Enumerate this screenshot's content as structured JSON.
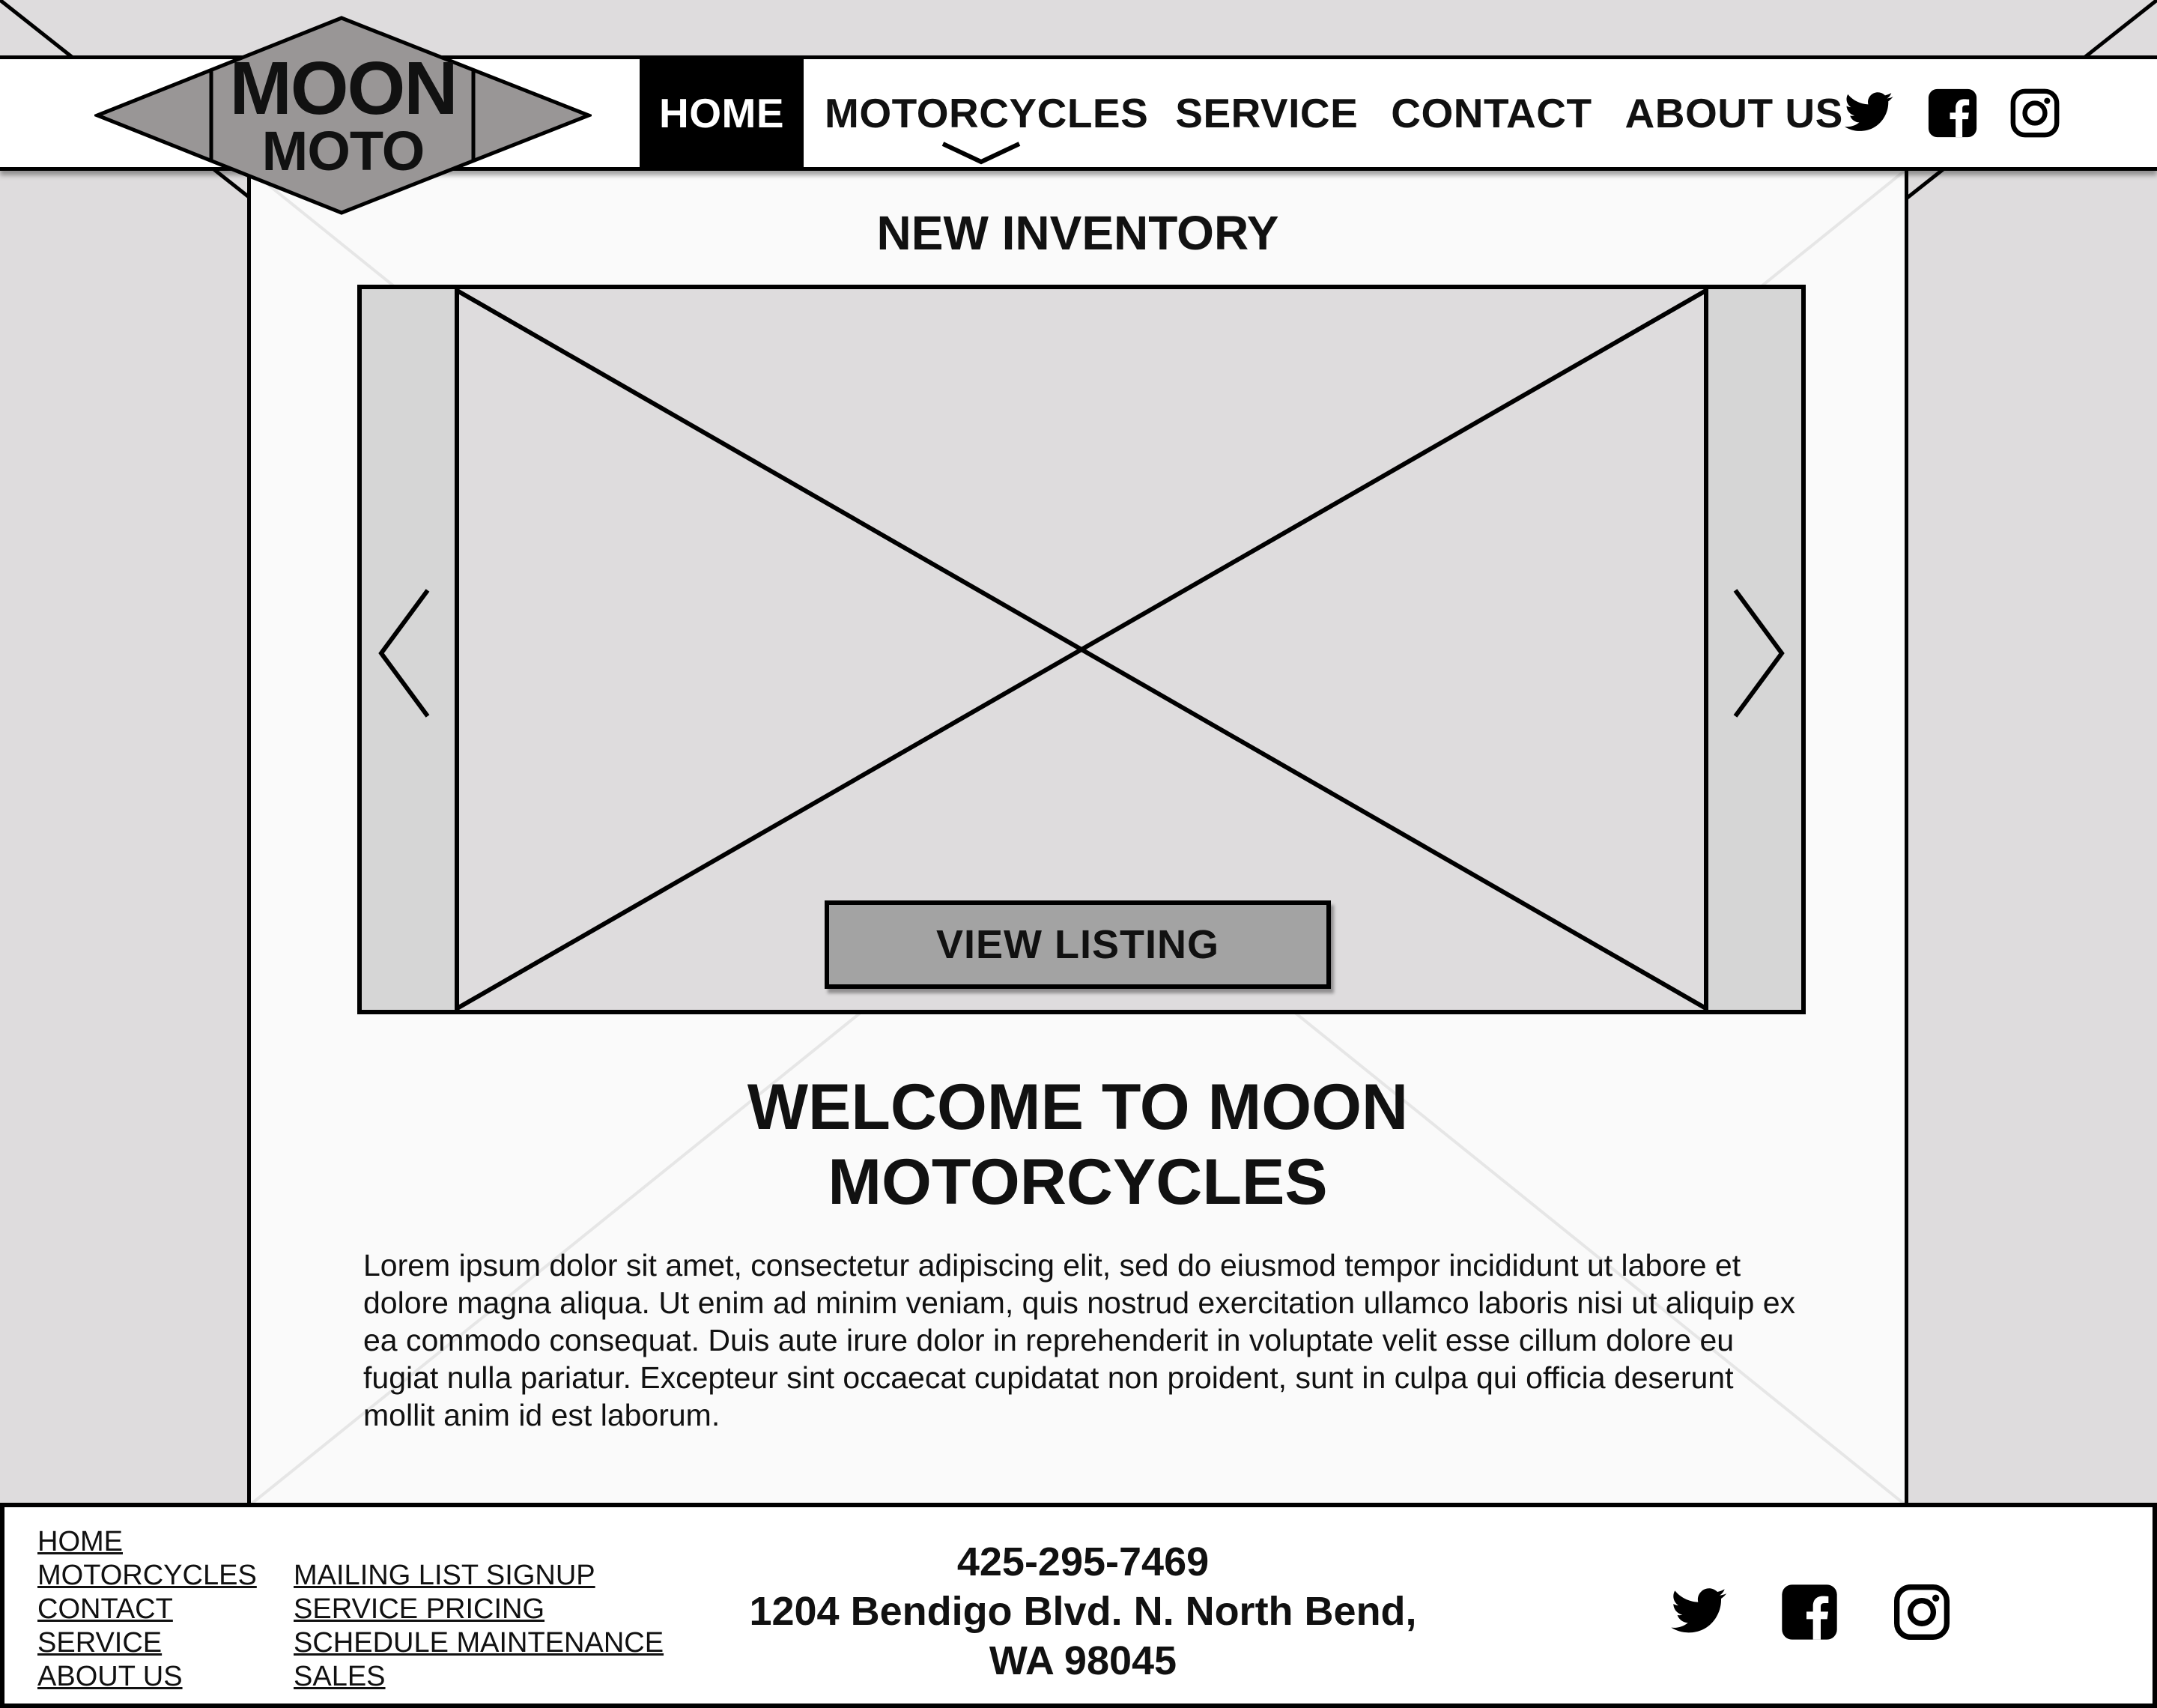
{
  "brand": {
    "line1": "MOON",
    "line2": "MOTO"
  },
  "nav": {
    "items": [
      {
        "label": "HOME",
        "active": true
      },
      {
        "label": "MOTORCYCLES",
        "active": false
      },
      {
        "label": "SERVICE",
        "active": false
      },
      {
        "label": "CONTACT",
        "active": false
      },
      {
        "label": "ABOUT US",
        "active": false
      }
    ],
    "social": [
      "twitter-icon",
      "facebook-icon",
      "instagram-icon"
    ]
  },
  "main": {
    "section_title": "NEW INVENTORY",
    "carousel": {
      "button_label": "VIEW LISTING",
      "prev_icon": "chevron-left-icon",
      "next_icon": "chevron-right-icon"
    },
    "welcome_line1": "WELCOME TO MOON",
    "welcome_line2": "MOTORCYCLES",
    "body": "Lorem ipsum dolor sit amet, consectetur adipiscing elit, sed do eiusmod tempor incididunt ut labore et dolore magna aliqua. Ut enim ad minim veniam, quis nostrud exercitation ullamco laboris nisi ut aliquip ex ea commodo consequat. Duis aute irure dolor in reprehenderit in voluptate velit esse cillum dolore eu fugiat nulla pariatur. Excepteur sint occaecat cupidatat non proident, sunt in culpa qui officia deserunt mollit anim id est laborum."
  },
  "footer": {
    "col1": [
      "HOME",
      "MOTORCYCLES",
      "CONTACT",
      "SERVICE",
      "ABOUT US"
    ],
    "col2": [
      "MAILING LIST SIGNUP",
      "SERVICE PRICING",
      "SCHEDULE MAINTENANCE",
      "SALES"
    ],
    "phone": "425-295-7469",
    "address_line1": "1204 Bendigo Blvd. N. North Bend,",
    "address_line2": "WA 98045",
    "social": [
      "twitter-icon",
      "facebook-icon",
      "instagram-icon"
    ]
  },
  "colors": {
    "background": "#dedcdd",
    "content": "#fafafa",
    "button": "#a3a3a3",
    "logo": "#999696",
    "ink": "#000000"
  }
}
